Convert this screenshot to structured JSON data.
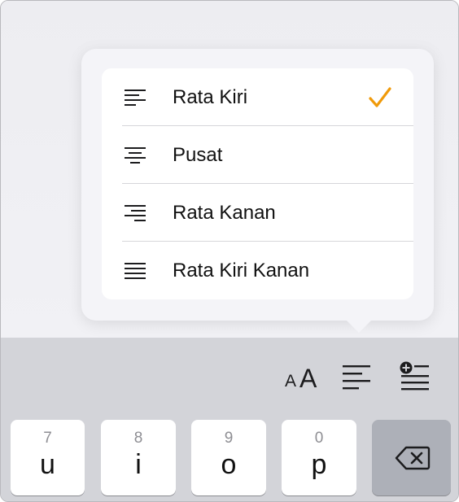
{
  "alignment_menu": {
    "items": [
      {
        "label": "Rata Kiri",
        "icon": "align-left-icon",
        "selected": true
      },
      {
        "label": "Pusat",
        "icon": "align-center-icon",
        "selected": false
      },
      {
        "label": "Rata Kanan",
        "icon": "align-right-icon",
        "selected": false
      },
      {
        "label": "Rata Kiri Kanan",
        "icon": "align-justify-icon",
        "selected": false
      }
    ],
    "checkmark_color": "#f09a0a"
  },
  "toolbar": {
    "text_size_small": "A",
    "text_size_large": "A",
    "buttons": [
      "text-size-icon",
      "paragraph-align-icon",
      "insert-list-item-icon"
    ]
  },
  "keyboard": {
    "keys": [
      {
        "hint": "7",
        "main": "u"
      },
      {
        "hint": "8",
        "main": "i"
      },
      {
        "hint": "9",
        "main": "o"
      },
      {
        "hint": "0",
        "main": "p"
      }
    ],
    "delete_icon": "delete-backspace-icon"
  }
}
